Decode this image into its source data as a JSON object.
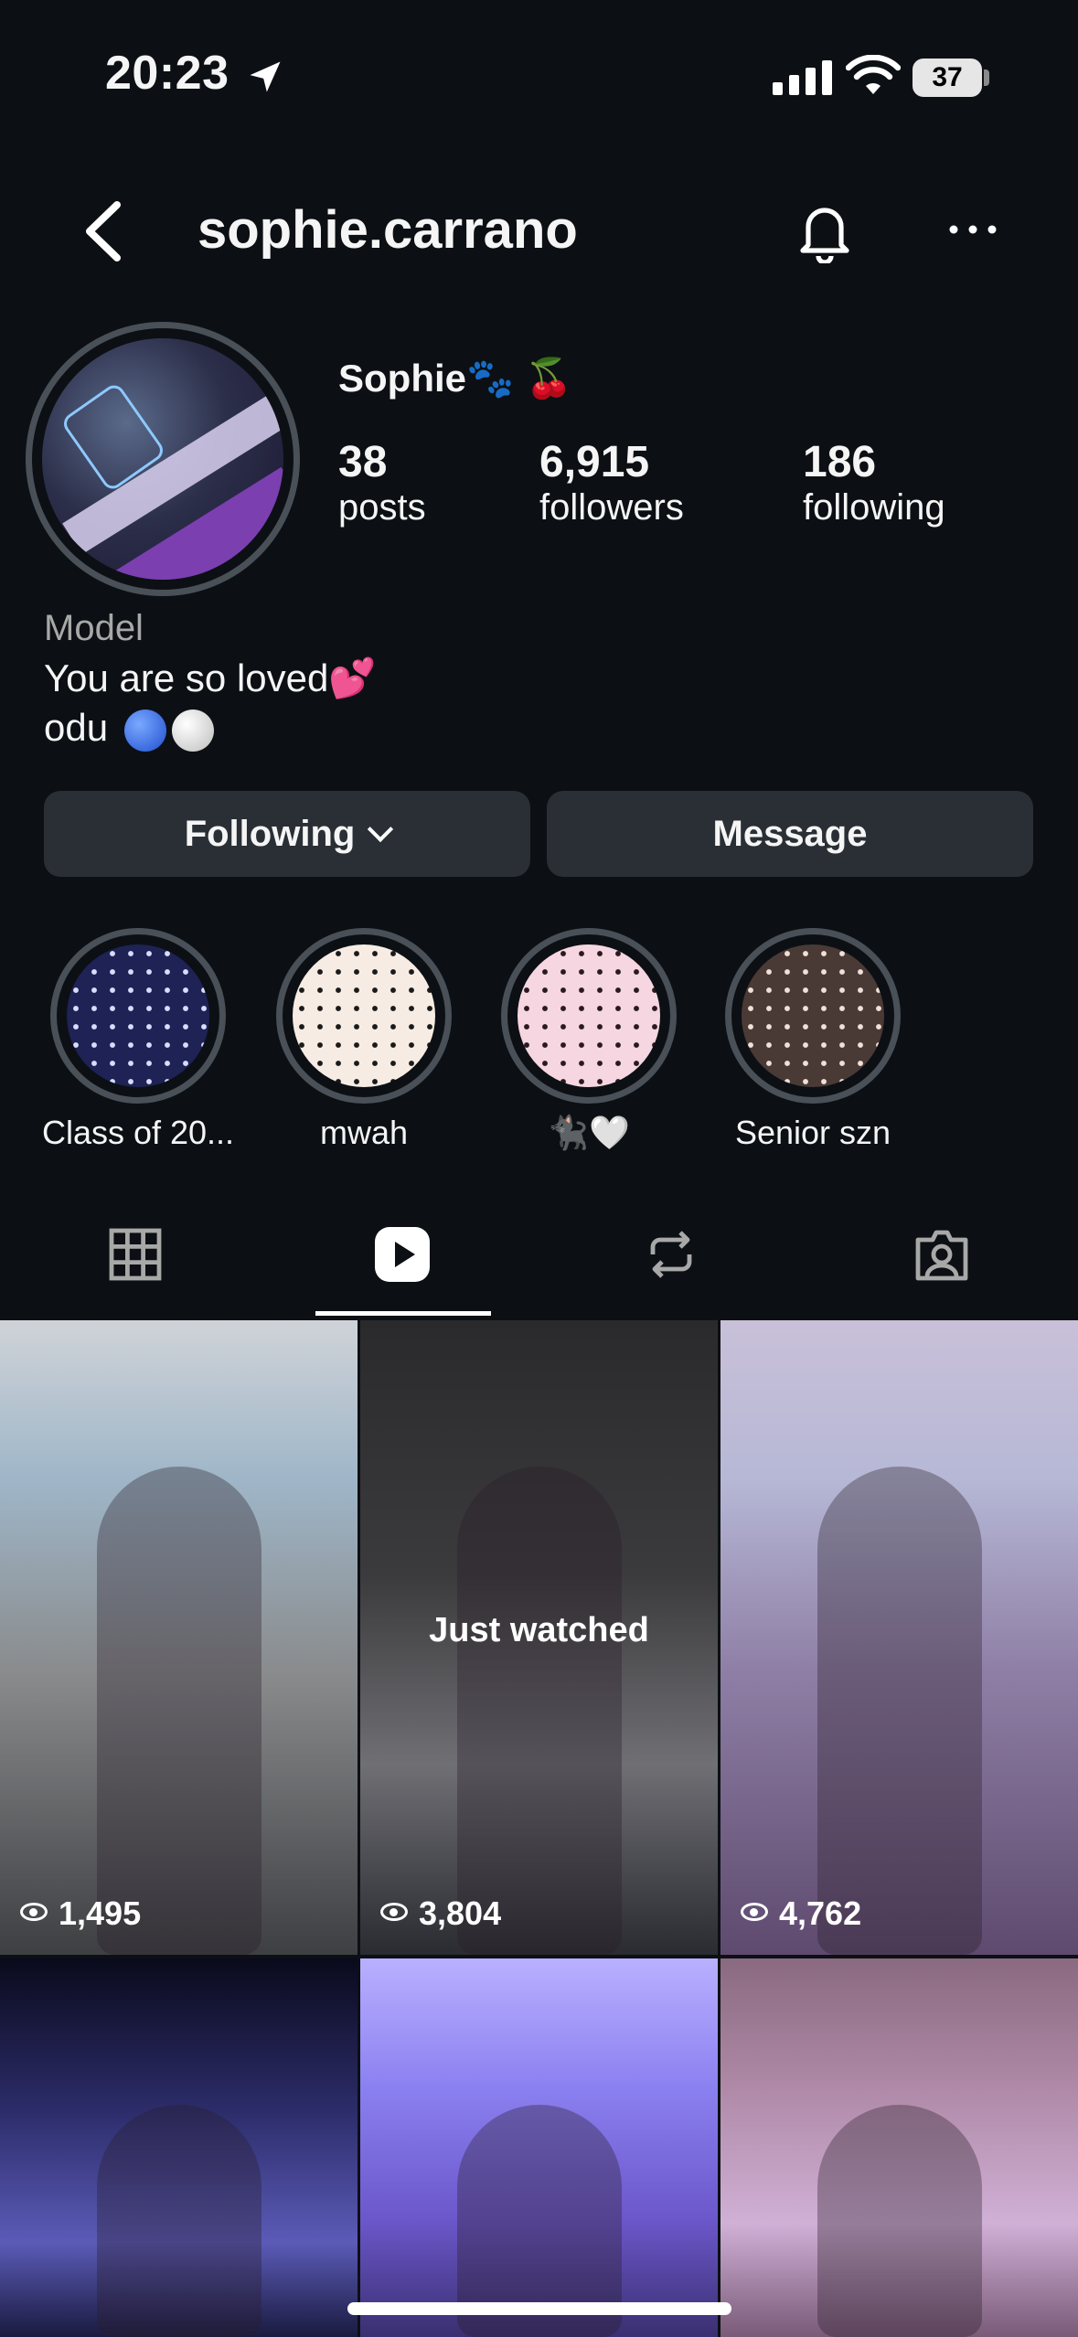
{
  "status_bar": {
    "time": "20:23",
    "battery": "37"
  },
  "header": {
    "username": "sophie.carrano"
  },
  "profile": {
    "display_name": "Sophie🐾 🍒",
    "stats": [
      {
        "value": "38",
        "label": "posts"
      },
      {
        "value": "6,915",
        "label": "followers"
      },
      {
        "value": "186",
        "label": "following"
      }
    ],
    "category": "Model",
    "bio_line1": "You are so loved💕",
    "bio_line2": "odu"
  },
  "actions": {
    "following_label": "Following",
    "message_label": "Message"
  },
  "highlights": [
    {
      "label": "Class of 20...",
      "bg": "#1e2255",
      "dot": "#d8dcff"
    },
    {
      "label": "mwah",
      "bg": "#f7ece4",
      "dot": "#1a1a1a"
    },
    {
      "label": "🐈‍⬛🤍",
      "bg": "#f6d6e0",
      "dot": "#2a1a20"
    },
    {
      "label": "Senior szn",
      "bg": "#4a3a36",
      "dot": "#f0e0d8"
    }
  ],
  "tabs": [
    {
      "name": "grid-icon"
    },
    {
      "name": "reels-icon"
    },
    {
      "name": "reposts-icon"
    },
    {
      "name": "tagged-icon"
    }
  ],
  "grid": [
    {
      "views": "1,495",
      "overlay": ""
    },
    {
      "views": "3,804",
      "overlay": "Just watched"
    },
    {
      "views": "4,762",
      "overlay": ""
    },
    {
      "views": "",
      "overlay": ""
    },
    {
      "views": "",
      "overlay": ""
    },
    {
      "views": "",
      "overlay": ""
    }
  ],
  "colors": {
    "background": "#0c1014",
    "button": "#2a2f35",
    "ring": "#4a5058"
  }
}
